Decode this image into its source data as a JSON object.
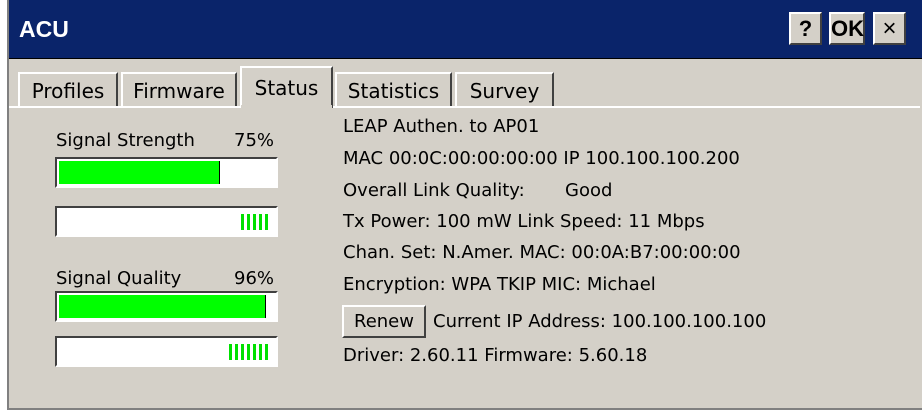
{
  "window": {
    "title": "ACU",
    "help_label": "?",
    "ok_label": "OK",
    "close_label": "×"
  },
  "tabs": [
    {
      "label": "Profiles",
      "active": false
    },
    {
      "label": "Firmware",
      "active": false
    },
    {
      "label": "Status",
      "active": true
    },
    {
      "label": "Statistics",
      "active": false
    },
    {
      "label": "Survey",
      "active": false
    }
  ],
  "signal": {
    "strength_label": "Signal Strength",
    "strength_value": "75%",
    "strength_fraction": 0.75,
    "strength_level_fraction": 0.75,
    "quality_label": "Signal Quality",
    "quality_value": "96%",
    "quality_fraction": 0.96,
    "quality_level_fraction": 0.96
  },
  "status": {
    "auth": "LEAP Authen. to AP01",
    "mac_ip": "MAC 00:0C:00:00:00:00  IP 100.100.100.200",
    "link_quality_label": "Overall Link Quality:",
    "link_quality_value": "Good",
    "tx_link": "Tx Power: 100 mW  Link Speed: 11 Mbps",
    "chan_mac": "Chan. Set: N.Amer.  MAC: 00:0A:B7:00:00:00",
    "encryption": "Encryption: WPA TKIP  MIC: Michael",
    "renew_label": "Renew",
    "current_ip": "Current IP Address:  100.100.100.100",
    "driver_firmware": "Driver: 2.60.11  Firmware: 5.60.18"
  },
  "colors": {
    "titlebar": "#0a246a",
    "face": "#d4d0c8",
    "bar_fill": "#00ff00"
  }
}
